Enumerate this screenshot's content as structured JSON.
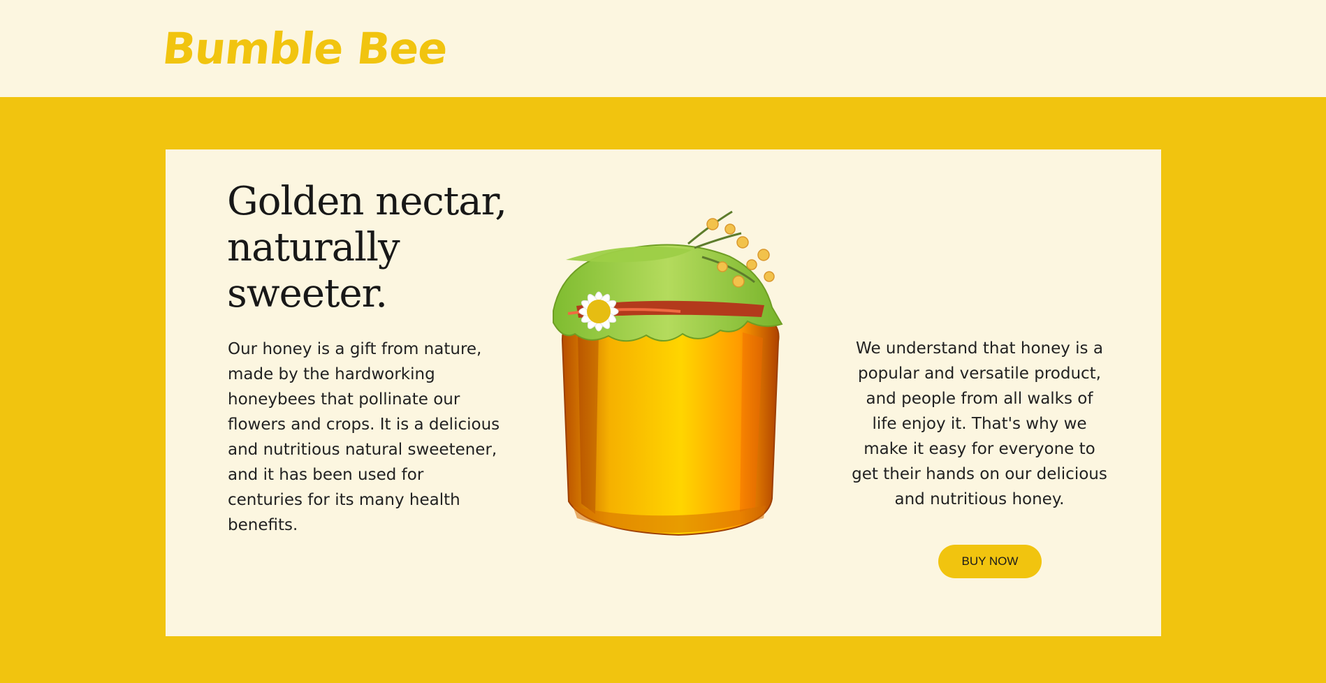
{
  "brand": {
    "name": "Bumble Bee",
    "color": "#f1c40f"
  },
  "hero": {
    "headline": "Golden nectar, naturally sweeter.",
    "left_copy": "Our honey is a gift from nature, made by the hardworking honeybees that pollinate our flowers and crops. It is a delicious and nutritious natural sweetener, and it has been used for centuries for its many health benefits.",
    "right_copy": "We understand that honey is a popular and versatile product, and people from all walks of life enjoy it. That's why we make it easy for everyone to get their hands on our delicious and nutritious honey.",
    "cta_label": "BUY NOW",
    "image_description": "honey-jar-with-flowers"
  },
  "colors": {
    "background": "#fcf6e0",
    "accent": "#f1c40f",
    "text": "#1d1d1b"
  }
}
